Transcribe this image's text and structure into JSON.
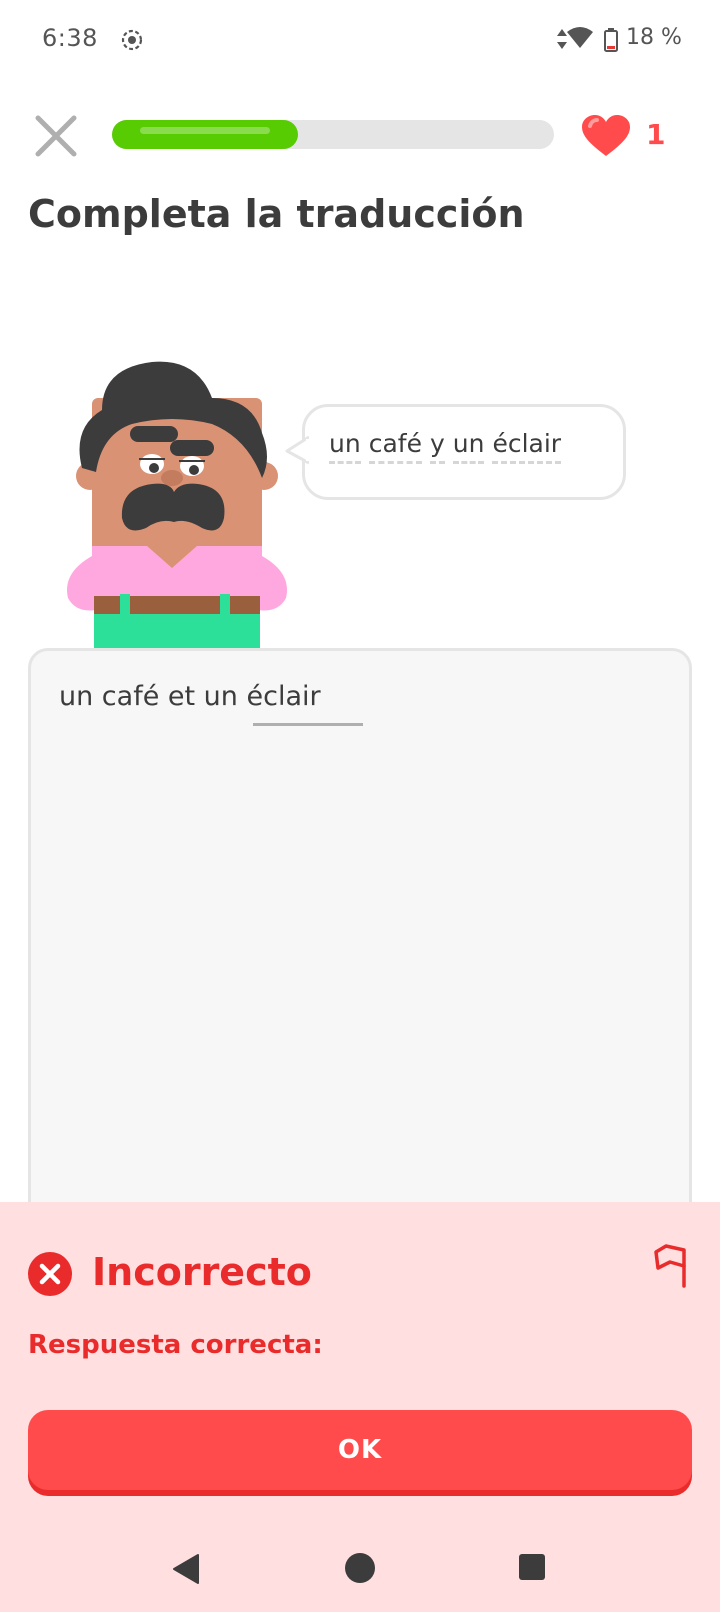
{
  "status_bar": {
    "time": "6:38",
    "battery": "18 %",
    "icons": [
      "screen-record-icon",
      "data-signal-icon",
      "wifi-icon",
      "battery-icon"
    ]
  },
  "header": {
    "close_icon": "close-icon",
    "progress": 0.42,
    "progress_color": "#58cc02",
    "hearts": "1",
    "heart_color": "#ff4b4b"
  },
  "prompt": {
    "title": "Completa la traducción",
    "bubble_words": [
      "un",
      "café",
      "y",
      "un",
      "éclair"
    ]
  },
  "answer": {
    "text": "un café et un éclair"
  },
  "feedback": {
    "title": "Incorrecto",
    "subtitle": "Respuesta correcta:",
    "button_label": "OK",
    "accent": "#ea2b2b",
    "background": "#ffdfe0"
  },
  "nav": {
    "icons": [
      "back-icon",
      "home-icon",
      "recents-icon"
    ]
  }
}
